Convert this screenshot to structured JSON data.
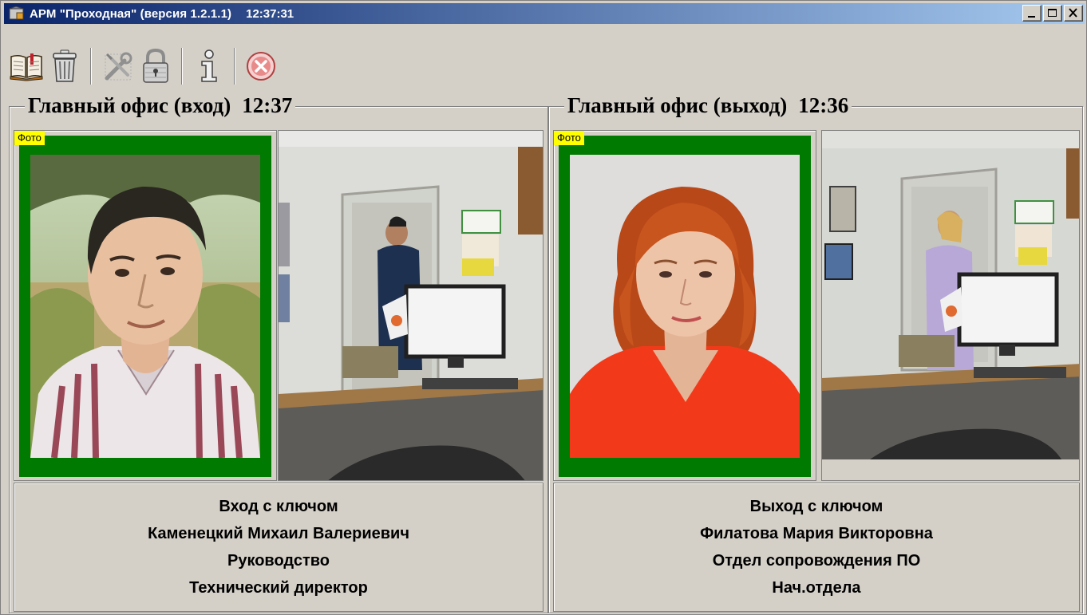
{
  "window": {
    "title": "АРМ \"Проходная\" (версия 1.2.1.1)",
    "time": "12:37:31",
    "controls": [
      "minimize",
      "maximize",
      "close"
    ]
  },
  "toolbar": {
    "items": [
      {
        "icon": "journal-book-icon"
      },
      {
        "icon": "trash-bin-icon"
      },
      {
        "icon": "settings-tools-icon"
      },
      {
        "icon": "padlock-icon"
      },
      {
        "icon": "info-icon"
      },
      {
        "icon": "exit-cancel-icon"
      }
    ]
  },
  "panels": [
    {
      "caption": "Главный офис (вход)",
      "time": "12:37",
      "photo_label": "Фото",
      "event": "Вход с ключом",
      "name": "Каменецкий Михаил Валериевич",
      "department": "Руководство",
      "position": "Технический директор"
    },
    {
      "caption": "Главный офис (выход)",
      "time": "12:36",
      "photo_label": "Фото",
      "event": "Выход с ключом",
      "name": "Филатова Мария Викторовна",
      "department": "Отдел сопровождения ПО",
      "position": "Нач.отдела"
    }
  ],
  "colors": {
    "window_bg": "#d4d0c8",
    "title_start": "#0a246a",
    "title_end": "#a6caf0",
    "photo_frame": "#007a00",
    "photo_label_bg": "#ffff00"
  }
}
